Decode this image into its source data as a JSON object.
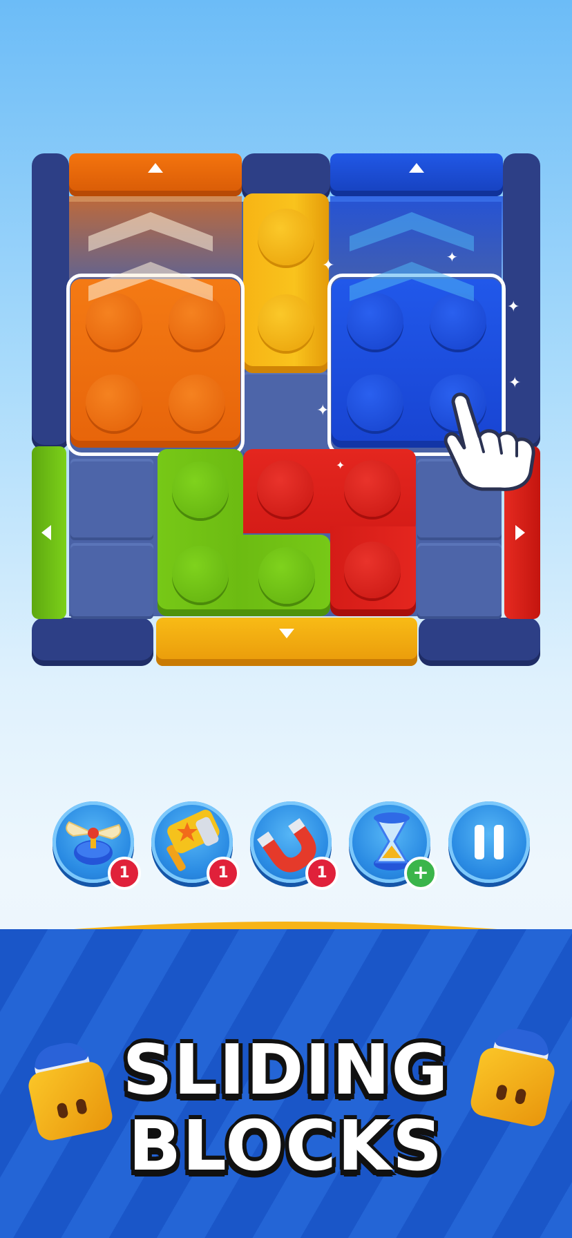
{
  "title": {
    "line1": "SLIDING",
    "line2": "BLOCKS"
  },
  "powerups": [
    {
      "name": "propeller",
      "count": "1"
    },
    {
      "name": "hammer",
      "count": "1"
    },
    {
      "name": "magnet",
      "count": "1"
    },
    {
      "name": "hourglass",
      "count": "+"
    },
    {
      "name": "pause",
      "count": ""
    }
  ],
  "colors": {
    "orange": "#f06d0c",
    "blue": "#1c4fe0",
    "yellow": "#f6b316",
    "red": "#dd1e1a",
    "green": "#72c415",
    "frame": "#2d3f86",
    "floor": "#4d65a9"
  }
}
